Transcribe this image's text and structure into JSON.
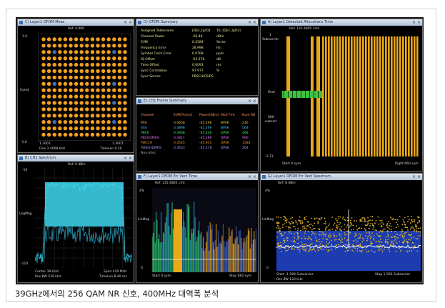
{
  "caption": "39GHz에서의 256 QAM NR 신호, 400MHz 대역폭 분석",
  "panels": {
    "constellation": {
      "title": "C) Layer1 OFDM Meas",
      "ref": "Ref: 4.000",
      "center_label": "Const",
      "left_scale_top": "1.0",
      "left_scale_bottom": "-1.0",
      "footer_left": "1.3007",
      "footer_right": "1.3007",
      "footer_start": "Fres 3.4008 kHz",
      "footer_stop": "TimeLen 0.20"
    },
    "summary": {
      "title": "D) OFDM Summary",
      "rows": [
        {
          "label": "Assigned Tablename",
          "value": "[DEF_tplt3]",
          "unit": "Tb: [DEF_tplt3]"
        },
        {
          "label": "Channel Power",
          "value": "-26.48",
          "unit": "dBm"
        },
        {
          "label": "EVM",
          "value": "0.3584",
          "unit": "%rms"
        },
        {
          "label": "Frequency Error",
          "value": "28.998",
          "unit": "Hz"
        },
        {
          "label": "Symbol Clock Error",
          "value": "0.0708",
          "unit": "ppm"
        },
        {
          "label": "IQ Offset",
          "value": "-65.576",
          "unit": "dB"
        },
        {
          "label": "Time Offset",
          "value": "0.0091",
          "unit": "ms"
        },
        {
          "label": "Sync Correlation",
          "value": "97.977",
          "unit": "%"
        },
        {
          "label": "Sync Source",
          "value": "PBSCH/CSIRS",
          "unit": ""
        }
      ]
    },
    "errors": {
      "title": "E) CH2 Frame Summary",
      "headers": [
        "Channel",
        "EVM[%rms]",
        "Power[dBm]",
        "Mod Fmt",
        "Num RB"
      ],
      "rows": [
        {
          "ch": "PSS",
          "evm": "0.4658",
          "pwr": "-45.298",
          "mod": "BPSK",
          "rb": "216",
          "color": "#f0d040"
        },
        {
          "ch": "SSS",
          "evm": "0.3896",
          "pwr": "-45.209",
          "mod": "BPSK",
          "rb": "564",
          "color": "#40d0f0"
        },
        {
          "ch": "PBCH",
          "evm": "0.3908",
          "pwr": "-45.248",
          "mod": "QPSK",
          "rb": "468",
          "color": "#40f070"
        },
        {
          "ch": "PBCHDMRS",
          "evm": "0.3811",
          "pwr": "-45.289",
          "mod": "QPSK",
          "rb": "990",
          "color": "#f070f0"
        },
        {
          "ch": "PDCCH",
          "evm": "0.3545",
          "pwr": "-45.931",
          "mod": "QPSK",
          "rb": "1584",
          "color": "#f0a030"
        },
        {
          "ch": "PDSCHDMRS",
          "evm": "0.3633",
          "pwr": "-45.278",
          "mod": "QPSK",
          "rb": "264",
          "color": "#a0a0ff"
        },
        {
          "ch": "Non-alloc",
          "evm": "",
          "pwr": "",
          "mod": "",
          "rb": "",
          "color": "#b0b0b0"
        }
      ]
    },
    "allocation": {
      "title": "A) Layer1 Detected Allocations Time",
      "ref": "Ref: 135.4805 cmt",
      "left_label": "Real",
      "left_top": "1",
      "left_top_sub": "Subcarrier",
      "left_mid": "660",
      "left_mid_sub": "subcarr",
      "left_bottom": "-1.73",
      "footer_left": "Start 0 sym",
      "footer_right": "Right 660 sym"
    },
    "spectrum": {
      "title": "B) CH1 Spectrum",
      "ref": "Ref: 0 dBm",
      "scale_top": "-10",
      "scale_bottom": "-110",
      "scale_label": "LogMag",
      "footer_center": "Center 39 GHz",
      "footer_span": "Span 420 MHz",
      "footer_res": "Res BW 539 kHz",
      "footer_time": "TimeLen 8.40 ms"
    },
    "err_time": {
      "title": "F) Layer1 OFDM Err Vect Time",
      "ref": "Ref: 135.4805 cmt",
      "scale_label": "LinMag",
      "scale_top": "4%",
      "scale_bottom": "0",
      "footer_start": "Start 0 sym",
      "footer_stop": "Stop 660 sym"
    },
    "err_spectrum": {
      "title": "G) Layer1 OFDM Err Vect Spectrum",
      "ref": "Ref: 8 dBm",
      "scale_label": "LinMag",
      "scale_top": "4%",
      "scale_bottom": "0",
      "footer_start": "Start -1.584 Subcarrier",
      "footer_stop": "Stop 1.583 Subcarrier",
      "footer_res": "Res BW 120 kHz"
    }
  }
}
